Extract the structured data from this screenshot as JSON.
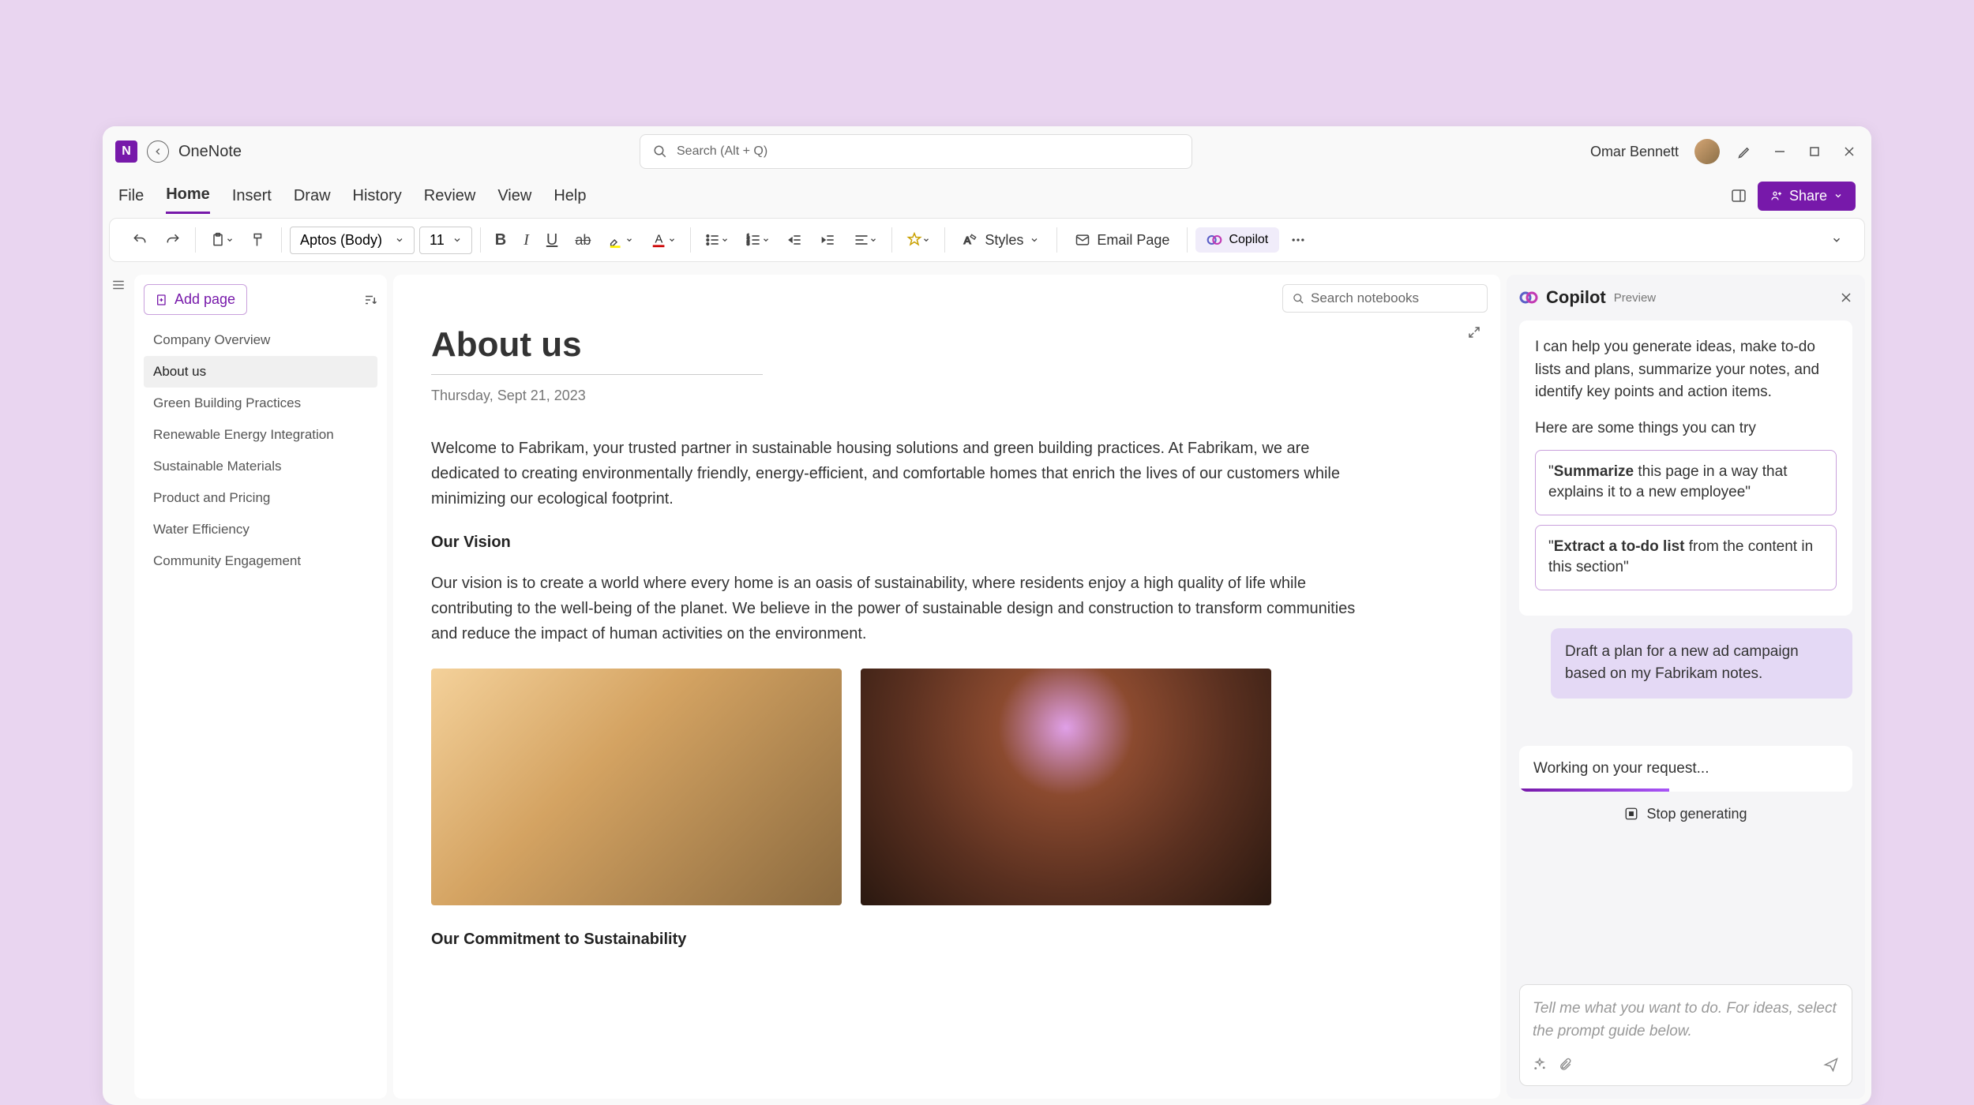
{
  "app": {
    "name": "OneNote"
  },
  "search": {
    "placeholder": "Search (Alt + Q)"
  },
  "user": {
    "name": "Omar Bennett"
  },
  "menu": {
    "items": [
      "File",
      "Home",
      "Insert",
      "Draw",
      "History",
      "Review",
      "View",
      "Help"
    ],
    "active": "Home",
    "share": "Share"
  },
  "ribbon": {
    "font": "Aptos (Body)",
    "size": "11",
    "styles": "Styles",
    "email": "Email Page",
    "copilot": "Copilot"
  },
  "search_notebooks": {
    "placeholder": "Search notebooks"
  },
  "pages": {
    "add": "Add page",
    "items": [
      "Company Overview",
      "About us",
      "Green Building Practices",
      "Renewable Energy Integration",
      "Sustainable Materials",
      "Product and Pricing",
      "Water Efficiency",
      "Community Engagement"
    ],
    "active": "About us"
  },
  "note": {
    "title": "About us",
    "date": "Thursday, Sept 21, 2023",
    "para1": "Welcome to Fabrikam, your trusted partner in sustainable housing solutions and green building practices. At Fabrikam, we are dedicated to creating environmentally friendly, energy-efficient, and comfortable homes that enrich the lives of our customers while minimizing our ecological footprint.",
    "heading1": "Our Vision",
    "para2": "Our vision is to create a world where every home is an oasis of sustainability, where residents enjoy a high quality of life while contributing to the well-being of the planet. We believe in the power of sustainable design and construction to transform communities and reduce the impact of human activities on the environment.",
    "heading2": "Our Commitment to Sustainability"
  },
  "copilot": {
    "title": "Copilot",
    "preview": "Preview",
    "intro": "I can help you generate ideas, make to-do lists and plans, summarize your notes, and identify key points and action items.",
    "subtext": "Here are some things you can try",
    "sugg1_bold": "Summarize",
    "sugg1_rest": " this page in a way that explains it to a new employee\"",
    "sugg2_bold": "Extract a to-do list",
    "sugg2_rest": " from the content in this section\"",
    "user_msg": "Draft a plan for a new ad campaign based on my Fabrikam notes.",
    "working": "Working on your request...",
    "stop": "Stop generating",
    "input_placeholder": "Tell me what you want to do. For ideas, select the prompt guide below."
  }
}
